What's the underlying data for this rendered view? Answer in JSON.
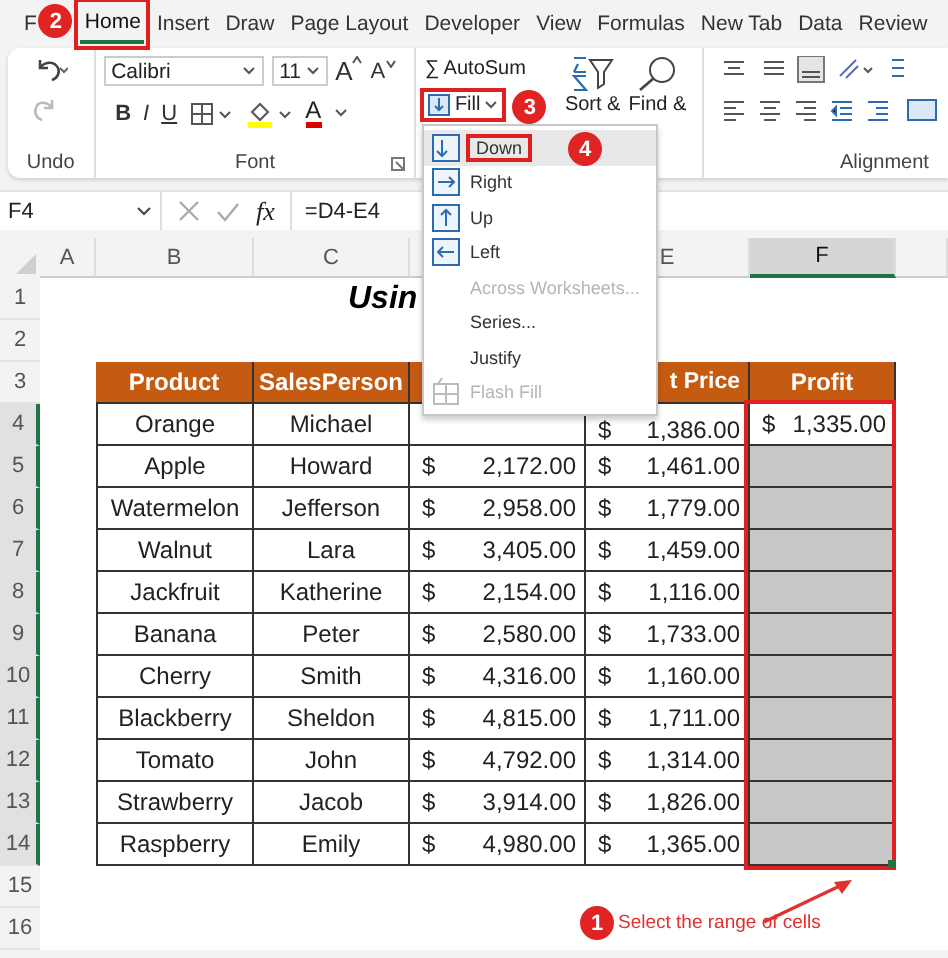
{
  "tabs": [
    {
      "label": "F",
      "selected": false
    },
    {
      "label": "Home",
      "selected": true,
      "highlighted": true,
      "badge": "2"
    },
    {
      "label": "Insert",
      "selected": false
    },
    {
      "label": "Draw",
      "selected": false
    },
    {
      "label": "Page Layout",
      "selected": false
    },
    {
      "label": "Developer",
      "selected": false
    },
    {
      "label": "View",
      "selected": false
    },
    {
      "label": "Formulas",
      "selected": false
    },
    {
      "label": "New Tab",
      "selected": false
    },
    {
      "label": "Data",
      "selected": false
    },
    {
      "label": "Review",
      "selected": false
    }
  ],
  "ribbon": {
    "undo_group": {
      "label": "Undo"
    },
    "font_group": {
      "font": "Calibri",
      "size": "11",
      "grow": "A",
      "shrink": "A",
      "styles": [
        "B",
        "I",
        "U"
      ],
      "font_color": "A",
      "label": "Font"
    },
    "editing_group": {
      "autosum_symbol": "∑",
      "autosum": "AutoSum",
      "fill": {
        "label": "Fill",
        "highlighted": true,
        "badge": "3"
      },
      "sort": "Sort &",
      "find": "Find &"
    },
    "alignment_group": {
      "label": "Alignment"
    }
  },
  "formula_bar": {
    "name_box": "F4",
    "fx": "fx",
    "formula": "=D4-E4"
  },
  "fill_menu": {
    "items": [
      {
        "label": "Down",
        "kind": "down",
        "selected": true,
        "highlighted": true,
        "badge": "4",
        "disabled": false
      },
      {
        "label": "Right",
        "kind": "right",
        "selected": false,
        "disabled": false
      },
      {
        "label": "Up",
        "kind": "up",
        "selected": false,
        "disabled": false
      },
      {
        "label": "Left",
        "kind": "left",
        "selected": false,
        "disabled": false
      },
      {
        "label": "Across Worksheets...",
        "kind": "plain",
        "selected": false,
        "disabled": true
      },
      {
        "label": "Series...",
        "kind": "plain",
        "selected": false,
        "disabled": false
      },
      {
        "label": "Justify",
        "kind": "plain",
        "selected": false,
        "disabled": false
      },
      {
        "label": "Flash Fill",
        "kind": "flash",
        "selected": false,
        "disabled": true
      }
    ]
  },
  "sheet": {
    "columns": [
      {
        "label": "A",
        "selected": false
      },
      {
        "label": "B",
        "selected": false
      },
      {
        "label": "C",
        "selected": false
      },
      {
        "label": "E",
        "selected": false
      },
      {
        "label": "F",
        "selected": true
      }
    ],
    "row_numbers": [
      {
        "label": "1",
        "selected": false
      },
      {
        "label": "2",
        "selected": false
      },
      {
        "label": "3",
        "selected": false
      },
      {
        "label": "4",
        "selected": true
      },
      {
        "label": "5",
        "selected": true
      },
      {
        "label": "6",
        "selected": true
      },
      {
        "label": "7",
        "selected": true
      },
      {
        "label": "8",
        "selected": true
      },
      {
        "label": "9",
        "selected": true
      },
      {
        "label": "10",
        "selected": true
      },
      {
        "label": "11",
        "selected": true
      },
      {
        "label": "12",
        "selected": true
      },
      {
        "label": "13",
        "selected": true
      },
      {
        "label": "14",
        "selected": true
      },
      {
        "label": "15",
        "selected": false
      },
      {
        "label": "16",
        "selected": false
      }
    ],
    "title": "Usin",
    "header": {
      "product": "Product",
      "salesperson": "SalesPerson",
      "cost": "t Price",
      "profit": "Profit"
    },
    "rows": [
      {
        "product": "Orange",
        "salesperson": "Michael",
        "cost_currency": "$",
        "cost": "1,386.00",
        "profit_currency": "$",
        "profit": "1,335.00",
        "selected": false
      },
      {
        "product": "Apple",
        "salesperson": "Howard",
        "sales_currency": "$",
        "sales": "2,172.00",
        "cost_currency": "$",
        "cost": "1,461.00",
        "selected": true
      },
      {
        "product": "Watermelon",
        "salesperson": "Jefferson",
        "sales_currency": "$",
        "sales": "2,958.00",
        "cost_currency": "$",
        "cost": "1,779.00",
        "selected": true
      },
      {
        "product": "Walnut",
        "salesperson": "Lara",
        "sales_currency": "$",
        "sales": "3,405.00",
        "cost_currency": "$",
        "cost": "1,459.00",
        "selected": true
      },
      {
        "product": "Jackfruit",
        "salesperson": "Katherine",
        "sales_currency": "$",
        "sales": "2,154.00",
        "cost_currency": "$",
        "cost": "1,116.00",
        "selected": true
      },
      {
        "product": "Banana",
        "salesperson": "Peter",
        "sales_currency": "$",
        "sales": "2,580.00",
        "cost_currency": "$",
        "cost": "1,733.00",
        "selected": true
      },
      {
        "product": "Cherry",
        "salesperson": "Smith",
        "sales_currency": "$",
        "sales": "4,316.00",
        "cost_currency": "$",
        "cost": "1,160.00",
        "selected": true
      },
      {
        "product": "Blackberry",
        "salesperson": "Sheldon",
        "sales_currency": "$",
        "sales": "4,815.00",
        "cost_currency": "$",
        "cost": "1,711.00",
        "selected": true
      },
      {
        "product": "Tomato",
        "salesperson": "John",
        "sales_currency": "$",
        "sales": "4,792.00",
        "cost_currency": "$",
        "cost": "1,314.00",
        "selected": true
      },
      {
        "product": "Strawberry",
        "salesperson": "Jacob",
        "sales_currency": "$",
        "sales": "3,914.00",
        "cost_currency": "$",
        "cost": "1,826.00",
        "selected": true
      },
      {
        "product": "Raspberry",
        "salesperson": "Emily",
        "sales_currency": "$",
        "sales": "4,980.00",
        "cost_currency": "$",
        "cost": "1,365.00",
        "selected": true
      }
    ]
  },
  "callout": {
    "badge": "1",
    "text": "Select the range of cells"
  }
}
